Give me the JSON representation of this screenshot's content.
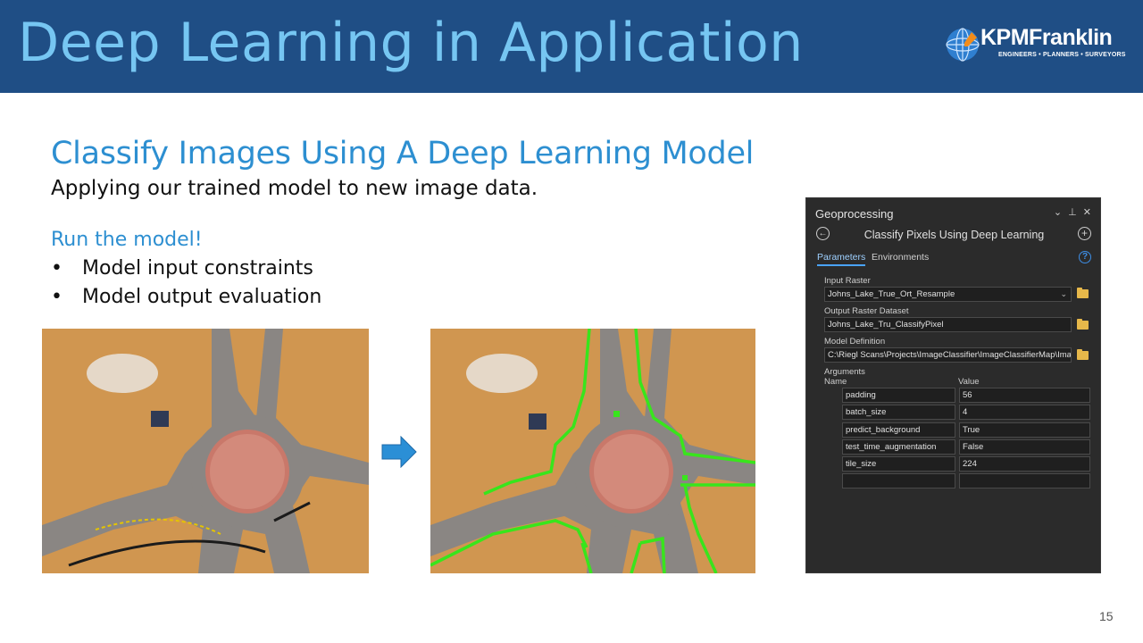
{
  "slide": {
    "title": "Deep Learning in Application",
    "subtitle": "Classify Images Using A Deep Learning Model",
    "lead": "Applying our trained model to new image data.",
    "run_heading": "Run the model!",
    "bullets": [
      "Model input constraints",
      "Model output evaluation"
    ],
    "bullet_glyph": "•",
    "page_number": "15"
  },
  "logo": {
    "name": "KPMFranklin",
    "tagline": "ENGINEERS • PLANNERS • SURVEYORS"
  },
  "geoprocessing": {
    "pane_title": "Geoprocessing",
    "controls": [
      "⌄",
      "⊥",
      "✕"
    ],
    "back_icon": "←",
    "tool_name": "Classify Pixels Using Deep Learning",
    "add_icon": "+",
    "tabs": [
      "Parameters",
      "Environments"
    ],
    "help_icon": "?",
    "fields": {
      "input_raster_label": "Input Raster",
      "input_raster_value": "Johns_Lake_True_Ort_Resample",
      "output_raster_label": "Output Raster Dataset",
      "output_raster_value": "Johns_Lake_Tru_ClassifyPixel",
      "model_definition_label": "Model Definition",
      "model_definition_value": "C:\\Riegl Scans\\Projects\\ImageClassifier\\ImageClassifierMap\\Ima"
    },
    "arguments_label": "Arguments",
    "columns": {
      "name": "Name",
      "value": "Value"
    },
    "arguments": [
      {
        "name": "padding",
        "value": "56"
      },
      {
        "name": "batch_size",
        "value": "4"
      },
      {
        "name": "predict_background",
        "value": "True"
      },
      {
        "name": "test_time_augmentation",
        "value": "False"
      },
      {
        "name": "tile_size",
        "value": "224"
      },
      {
        "name": "",
        "value": ""
      }
    ]
  },
  "colors": {
    "banner": "#1f4e85",
    "title_text": "#76c6f2",
    "accent_text": "#2d8fd1",
    "panel_bg": "#2b2b2b",
    "classified_road": "#38e51c"
  },
  "images": {
    "left": "aerial-roundabout-original",
    "right": "aerial-roundabout-classified",
    "arrow": "right-arrow-icon"
  }
}
